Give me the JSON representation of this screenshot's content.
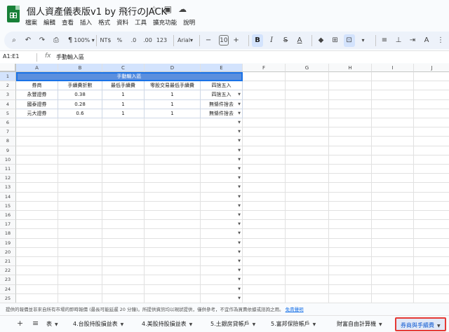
{
  "doc": {
    "title": "個人資產儀表版v1 by 飛行のJACK",
    "title_icons": [
      "star-icon",
      "folder-move-icon",
      "cloud-status-icon"
    ],
    "menu": [
      "檔案",
      "編輯",
      "查看",
      "插入",
      "格式",
      "資料",
      "工具",
      "擴充功能",
      "說明"
    ]
  },
  "toolbar": {
    "zoom": "100%",
    "currency": "NT$",
    "percent": "%",
    "dec_decrease": ".0",
    "dec_increase": ".00",
    "number_format": "123",
    "font": "Arial",
    "font_size": "10",
    "bold": "B",
    "italic": "I",
    "strike": "S",
    "text_color": "A"
  },
  "formula_bar": {
    "name_box": "A1:E1",
    "fx": "fx",
    "value": "手動輸入區"
  },
  "grid": {
    "columns": [
      "A",
      "B",
      "C",
      "D",
      "E",
      "F",
      "G",
      "H",
      "I",
      "J"
    ],
    "rows": [
      "1",
      "2",
      "3",
      "4",
      "5",
      "6",
      "7",
      "8",
      "9",
      "10",
      "11",
      "12",
      "13",
      "14",
      "15",
      "16",
      "17",
      "18",
      "19",
      "20",
      "21",
      "22",
      "23",
      "24",
      "25"
    ],
    "banner": "手動輸入區",
    "headers": [
      "券商",
      "手續費折數",
      "最低手續費",
      "零股交易最低手續費",
      "四捨五入"
    ],
    "data": [
      [
        "永豐證券",
        "0.38",
        "1",
        "1",
        "四捨五入"
      ],
      [
        "國泰證券",
        "0.28",
        "1",
        "1",
        "無條件捨去"
      ],
      [
        "元大證券",
        "0.6",
        "1",
        "1",
        "無條件捨去"
      ]
    ],
    "accent": "#5b8fde"
  },
  "notice": {
    "text": "提供的報價並非來自所有市場的即時報價 (最長可能延遲 20 分鐘)。所提供資訊均以現狀提供，僅供參考，不宜作為買賣依據或諮詢之用。",
    "link": "免責聲明"
  },
  "tabs": {
    "items": [
      "4.台股持股損益表",
      "4.美股持股損益表",
      "5.土銀房貸帳戶",
      "5.富邦保險帳戶",
      "財富自由計算機",
      "券商與手續費"
    ],
    "truncated_prefix": "表",
    "active_index": 5
  }
}
